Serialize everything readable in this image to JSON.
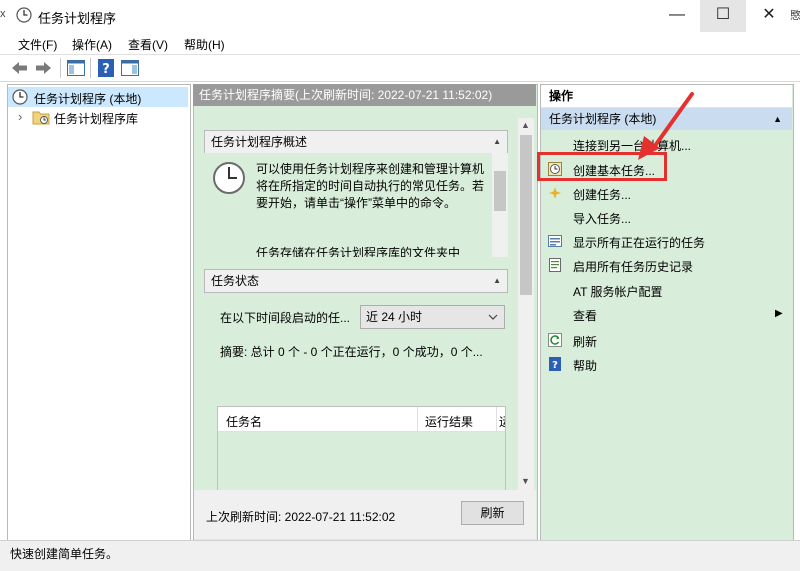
{
  "window": {
    "title": "任务计划程序",
    "min": "—",
    "max": "☐",
    "close": "✕",
    "left_edge_glyph": "x",
    "right_edge_text": "愍"
  },
  "menu": [
    "文件(F)",
    "操作(A)",
    "查看(V)",
    "帮助(H)"
  ],
  "tree": {
    "root": "任务计划程序 (本地)",
    "child": "任务计划程序库",
    "expand_glyph": "›"
  },
  "center": {
    "header": "任务计划程序摘要(上次刷新时间: 2022-07-21 11:52:02)",
    "overview": {
      "title": "任务计划程序概述",
      "collapse_glyph": "▲",
      "text": "可以使用任务计划程序来创建和管理计算机将在所指定的时间自动执行的常见任务。若要开始，请单击“操作”菜单中的命令。",
      "more": "任务存储在任务计划程序库的文件夹中"
    },
    "status": {
      "title": "任务状态",
      "collapse_glyph": "▲",
      "range_label": "在以下时间段启动的任...",
      "range_value": "近 24 小时",
      "summary": "摘要: 总计 0 个 - 0 个正在运行，0 个成功，0 个...",
      "columns": [
        "任务名",
        "运行结果",
        "运"
      ]
    },
    "last_refresh": "上次刷新时间: 2022-07-21 11:52:02",
    "refresh_button": "刷新",
    "scroll_up": "▲",
    "scroll_down": "▼"
  },
  "actions": {
    "header": "操作",
    "section": "任务计划程序 (本地)",
    "section_arrow": "▲",
    "items": [
      {
        "label": "连接到另一台计算机...",
        "icon": "none"
      },
      {
        "label": "创建基本任务...",
        "icon": "clock-task-icon"
      },
      {
        "label": "创建任务...",
        "icon": "new-task-icon"
      },
      {
        "label": "导入任务...",
        "icon": "none"
      },
      {
        "label": "显示所有正在运行的任务",
        "icon": "running-tasks-icon"
      },
      {
        "label": "启用所有任务历史记录",
        "icon": "history-icon"
      },
      {
        "label": "AT 服务帐户配置",
        "icon": "none"
      },
      {
        "label": "查看",
        "icon": "none"
      },
      {
        "label": "刷新",
        "icon": "refresh-icon"
      },
      {
        "label": "帮助",
        "icon": "help-icon"
      }
    ],
    "submenu_arrow": "▶"
  },
  "status_bar": "快速创建简单任务。",
  "colors": {
    "panel_bg": "#d9eeda",
    "selection": "#cce8ff",
    "annotation": "#e53030"
  }
}
